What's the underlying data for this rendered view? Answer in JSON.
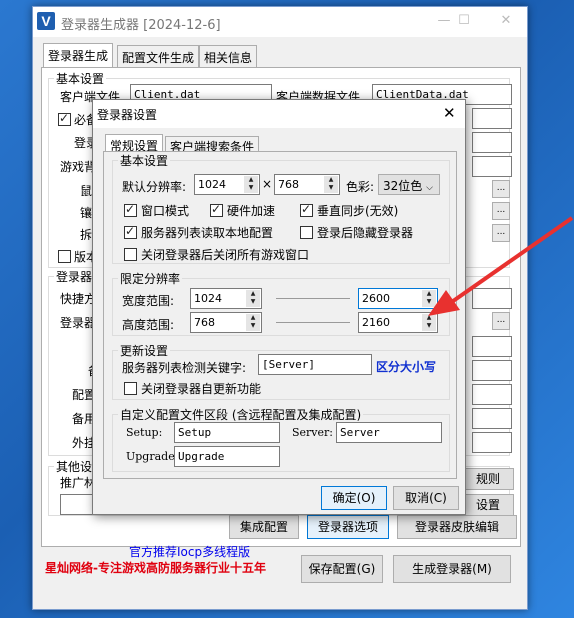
{
  "main_window": {
    "title": "登录器生成器 [2024-12-6]",
    "app_icon": "V",
    "tabs": [
      {
        "label": "登录器生成"
      },
      {
        "label": "配置文件生成"
      },
      {
        "label": "相关信息"
      }
    ],
    "basic_settings": {
      "title": "基本设置",
      "client_file_label": "客户端文件",
      "client_file_value": "Client.dat",
      "client_data_label": "客户端数据文件",
      "client_data_value": "ClientData.dat",
      "required_label": "必备",
      "login_label": "登录",
      "game_label": "游戏背",
      "cursor_label": "鼠标",
      "shield_label": "镶嵌",
      "split_label": "拆卸",
      "version_label": "版本"
    },
    "launcher_section": {
      "title": "登录器",
      "shortcut_label": "快捷方",
      "launcher_label": "登录器",
      "backup_label": "备",
      "config_label": "配置",
      "alt_label": "备用",
      "external_label": "外挂"
    },
    "other_section": {
      "title": "其他设",
      "promo_label": "推广林",
      "rules_btn": "规则",
      "settings_btn": "设置"
    },
    "bottom_buttons": {
      "integrated_config": "集成配置",
      "launcher_options": "登录器选项",
      "skin_editor": "登录器皮肤编辑",
      "save_config": "保存配置(G)",
      "generate_launcher": "生成登录器(M)"
    },
    "recommend_text": "官方推荐Iocp多线程版",
    "brand_text": "星灿网络-专注游戏高防服务器行业十五年",
    "dots_label": "..."
  },
  "dialog": {
    "title": "登录器设置",
    "close_icon": "close-icon",
    "tabs": [
      {
        "label": "常规设置"
      },
      {
        "label": "客户端搜索条件"
      }
    ],
    "basic": {
      "title": "基本设置",
      "default_res_label": "默认分辨率:",
      "res_width": "1024",
      "times_sign": "×",
      "res_height": "768",
      "color_label": "色彩:",
      "color_value": "32位色",
      "checkboxes": [
        {
          "label": "窗口模式",
          "checked": true
        },
        {
          "label": "硬件加速",
          "checked": true
        },
        {
          "label": "垂直同步(无效)",
          "checked": true
        },
        {
          "label": "服务器列表读取本地配置",
          "checked": true
        },
        {
          "label": "登录后隐藏登录器",
          "checked": false
        },
        {
          "label": "关闭登录器后关闭所有游戏窗口",
          "checked": false
        }
      ]
    },
    "limit_res": {
      "title": "限定分辨率",
      "width_label": "宽度范围:",
      "width_min": "1024",
      "width_max": "2600",
      "height_label": "高度范围:",
      "height_min": "768",
      "height_max": "2160"
    },
    "update": {
      "title": "更新设置",
      "keyword_label": "服务器列表检测关键字:",
      "keyword_value": "[Server]",
      "case_note": "区分大小写",
      "self_update_label": "关闭登录器自更新功能",
      "self_update_checked": false
    },
    "custom_config": {
      "title": "自定义配置文件区段 (含远程配置及集成配置)",
      "setup_label": "Setup:",
      "setup_value": "Setup",
      "server_label": "Server:",
      "server_value": "Server",
      "upgrade_label": "Upgrade:",
      "upgrade_value": "Upgrade"
    },
    "ok_label": "确定(O)",
    "cancel_label": "取消(C)"
  },
  "colors": {
    "desktop": "#1e63b8",
    "annotation_arrow": "#e8312f",
    "brand_red": "#e0000f",
    "link_blue": "#0000ee"
  }
}
